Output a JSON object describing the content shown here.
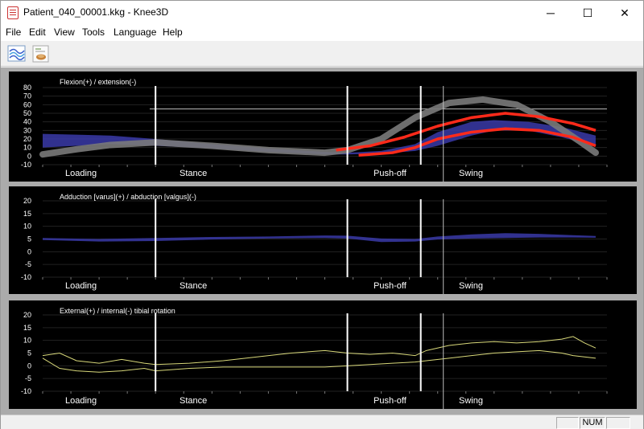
{
  "window": {
    "title": "Patient_040_00001.kkg - Knee3D",
    "minimize": "─",
    "maximize": "☐",
    "close": "✕"
  },
  "menu": [
    "File",
    "Edit",
    "View",
    "Tools",
    "Language",
    "Help"
  ],
  "toolbar": {
    "buttons": [
      {
        "icon": "curves-chart-icon"
      },
      {
        "icon": "knee-report-icon"
      }
    ]
  },
  "phases": [
    "Loading",
    "Stance",
    "Push-off",
    "Swing"
  ],
  "colors": {
    "normative_band": "#3a3aa8",
    "gray_curve": "#7a7a7a",
    "red_curve": "#ff2a1a",
    "yellow_curve": "#d8d87a",
    "phase_line": "#ffffff"
  },
  "chart_data": [
    {
      "type": "line",
      "title": "Flexion(+) / extension(-)",
      "ylim": [
        -10,
        80
      ],
      "yticks": [
        "80",
        "70",
        "60",
        "50",
        "40",
        "30",
        "20",
        "10",
        "0",
        "-10"
      ],
      "xlim": [
        0,
        100
      ],
      "phase_lines": [
        20,
        54,
        67
      ],
      "thin_line": 71,
      "ref_line": 55,
      "band": {
        "x": [
          0,
          6,
          12,
          20,
          30,
          40,
          50,
          54,
          60,
          66,
          70,
          76,
          80,
          86,
          92,
          98
        ],
        "upper": [
          26,
          25,
          24,
          20,
          14,
          9,
          5,
          4,
          6,
          14,
          28,
          40,
          42,
          40,
          34,
          24
        ],
        "lower": [
          10,
          12,
          14,
          12,
          9,
          5,
          2,
          2,
          3,
          6,
          12,
          24,
          30,
          30,
          22,
          12
        ]
      },
      "gray": {
        "x": [
          0,
          6,
          12,
          20,
          30,
          40,
          50,
          54,
          60,
          66,
          72,
          78,
          84,
          90,
          95,
          98
        ],
        "values": [
          2,
          8,
          13,
          16,
          12,
          7,
          4,
          7,
          20,
          45,
          62,
          66,
          60,
          40,
          18,
          4
        ]
      },
      "red": [
        {
          "x": [
            52,
            58,
            64,
            70,
            76,
            82,
            88,
            94,
            98
          ],
          "values": [
            7,
            12,
            22,
            35,
            45,
            50,
            46,
            38,
            30
          ]
        },
        {
          "x": [
            56,
            62,
            66,
            70,
            76,
            82,
            88,
            94,
            98
          ],
          "values": [
            1,
            4,
            10,
            20,
            28,
            32,
            30,
            22,
            12
          ]
        }
      ]
    },
    {
      "type": "line",
      "title": "Adduction [varus](+) / abduction [valgus](-)",
      "ylim": [
        -10,
        20
      ],
      "yticks": [
        "20",
        "15",
        "10",
        "5",
        "0",
        "-5",
        "-10"
      ],
      "xlim": [
        0,
        100
      ],
      "phase_lines": [
        20,
        54,
        67
      ],
      "thin_line": 71,
      "band": {
        "x": [
          0,
          10,
          20,
          30,
          40,
          50,
          54,
          60,
          66,
          70,
          76,
          82,
          88,
          94,
          98
        ],
        "upper": [
          5.4,
          5.0,
          5.4,
          5.8,
          6.0,
          6.4,
          6.3,
          5.2,
          5.0,
          6.0,
          6.8,
          7.3,
          7.0,
          6.5,
          6.2
        ],
        "lower": [
          4.6,
          4.0,
          4.2,
          4.8,
          5.2,
          5.4,
          5.2,
          3.8,
          4.0,
          4.8,
          5.2,
          5.4,
          5.6,
          5.6,
          5.5
        ]
      }
    },
    {
      "type": "line",
      "title": "External(+) / internal(-) tibial rotation",
      "ylim": [
        -10,
        20
      ],
      "yticks": [
        "20",
        "15",
        "10",
        "5",
        "0",
        "-5",
        "-10"
      ],
      "xlim": [
        0,
        100
      ],
      "phase_lines": [
        20,
        54,
        67
      ],
      "thin_line": 71,
      "series": [
        {
          "x": [
            0,
            3,
            6,
            10,
            14,
            18,
            20,
            26,
            32,
            38,
            44,
            50,
            54,
            58,
            62,
            66,
            68,
            72,
            76,
            80,
            84,
            88,
            92,
            94,
            96,
            98
          ],
          "values": [
            4,
            5,
            2,
            1,
            2.5,
            1,
            0.5,
            1,
            2,
            3.5,
            5,
            6,
            5,
            4.5,
            5,
            4,
            6,
            8,
            9,
            9.5,
            9,
            9.5,
            10.5,
            11.5,
            9,
            7
          ]
        },
        {
          "x": [
            0,
            3,
            6,
            10,
            14,
            18,
            20,
            26,
            32,
            38,
            44,
            50,
            54,
            58,
            62,
            66,
            68,
            72,
            76,
            80,
            84,
            88,
            92,
            94,
            96,
            98
          ],
          "values": [
            3,
            -1,
            -2,
            -2.5,
            -2,
            -1,
            -2,
            -1,
            -0.5,
            -0.5,
            -0.5,
            -0.5,
            0,
            0.5,
            1,
            1.5,
            2,
            3,
            4,
            5,
            5.5,
            6,
            5,
            4,
            3.5,
            3
          ]
        }
      ]
    }
  ],
  "status": {
    "pane1": "",
    "num": "NUM",
    "pane3": ""
  }
}
